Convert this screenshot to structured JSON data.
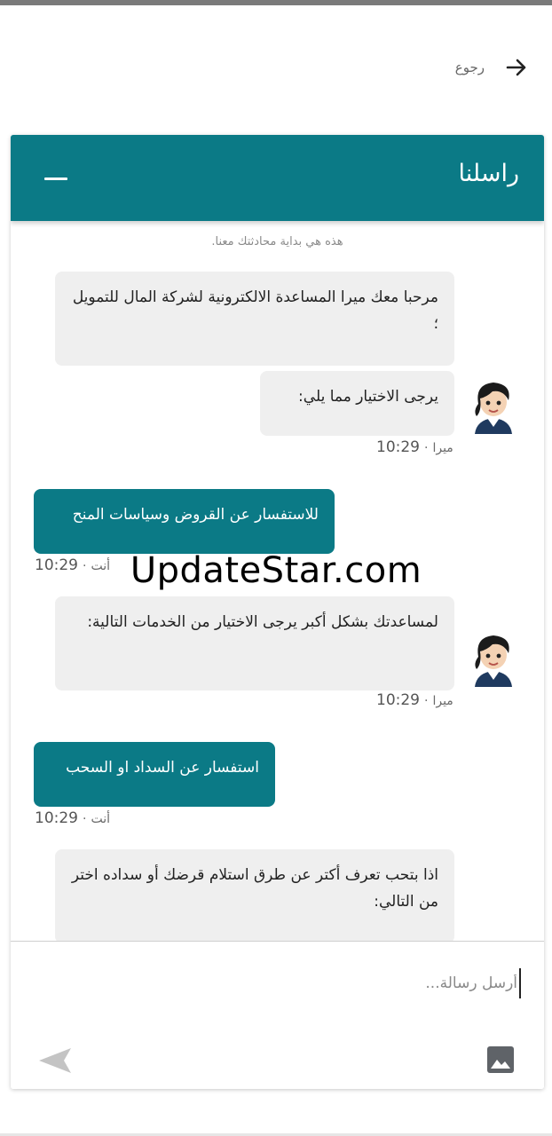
{
  "nav": {
    "back_label": "رجوع"
  },
  "chat": {
    "title": "راسلنا",
    "intro": "هذه هي بداية محادثتك معنا.",
    "bot_name": "ميرا",
    "user_name": "أنت",
    "separator": "·",
    "messages": [
      {
        "text": "مرحبا معك ميرا المساعدة الالكترونية لشركة المال للتمويل ؛"
      },
      {
        "text": "يرجى الاختيار مما يلي:"
      },
      {
        "text": "للاستفسار عن القروض وسياسات المنح"
      },
      {
        "text": "لمساعدتك بشكل أكبر يرجى الاختيار من الخدمات التالية:"
      },
      {
        "text": "استفسار عن السداد او السحب"
      },
      {
        "text": "اذا بتحب تعرف أكتر عن طرق استلام قرضك أو سداده اختر من التالي:"
      }
    ],
    "timestamps": [
      "10:29",
      "10:29",
      "10:29",
      "10:29"
    ]
  },
  "composer": {
    "placeholder": "أرسل رسالة..."
  },
  "watermark": "UpdateStar.com",
  "colors": {
    "accent": "#0b7a86",
    "bot_bubble": "#efefef"
  }
}
